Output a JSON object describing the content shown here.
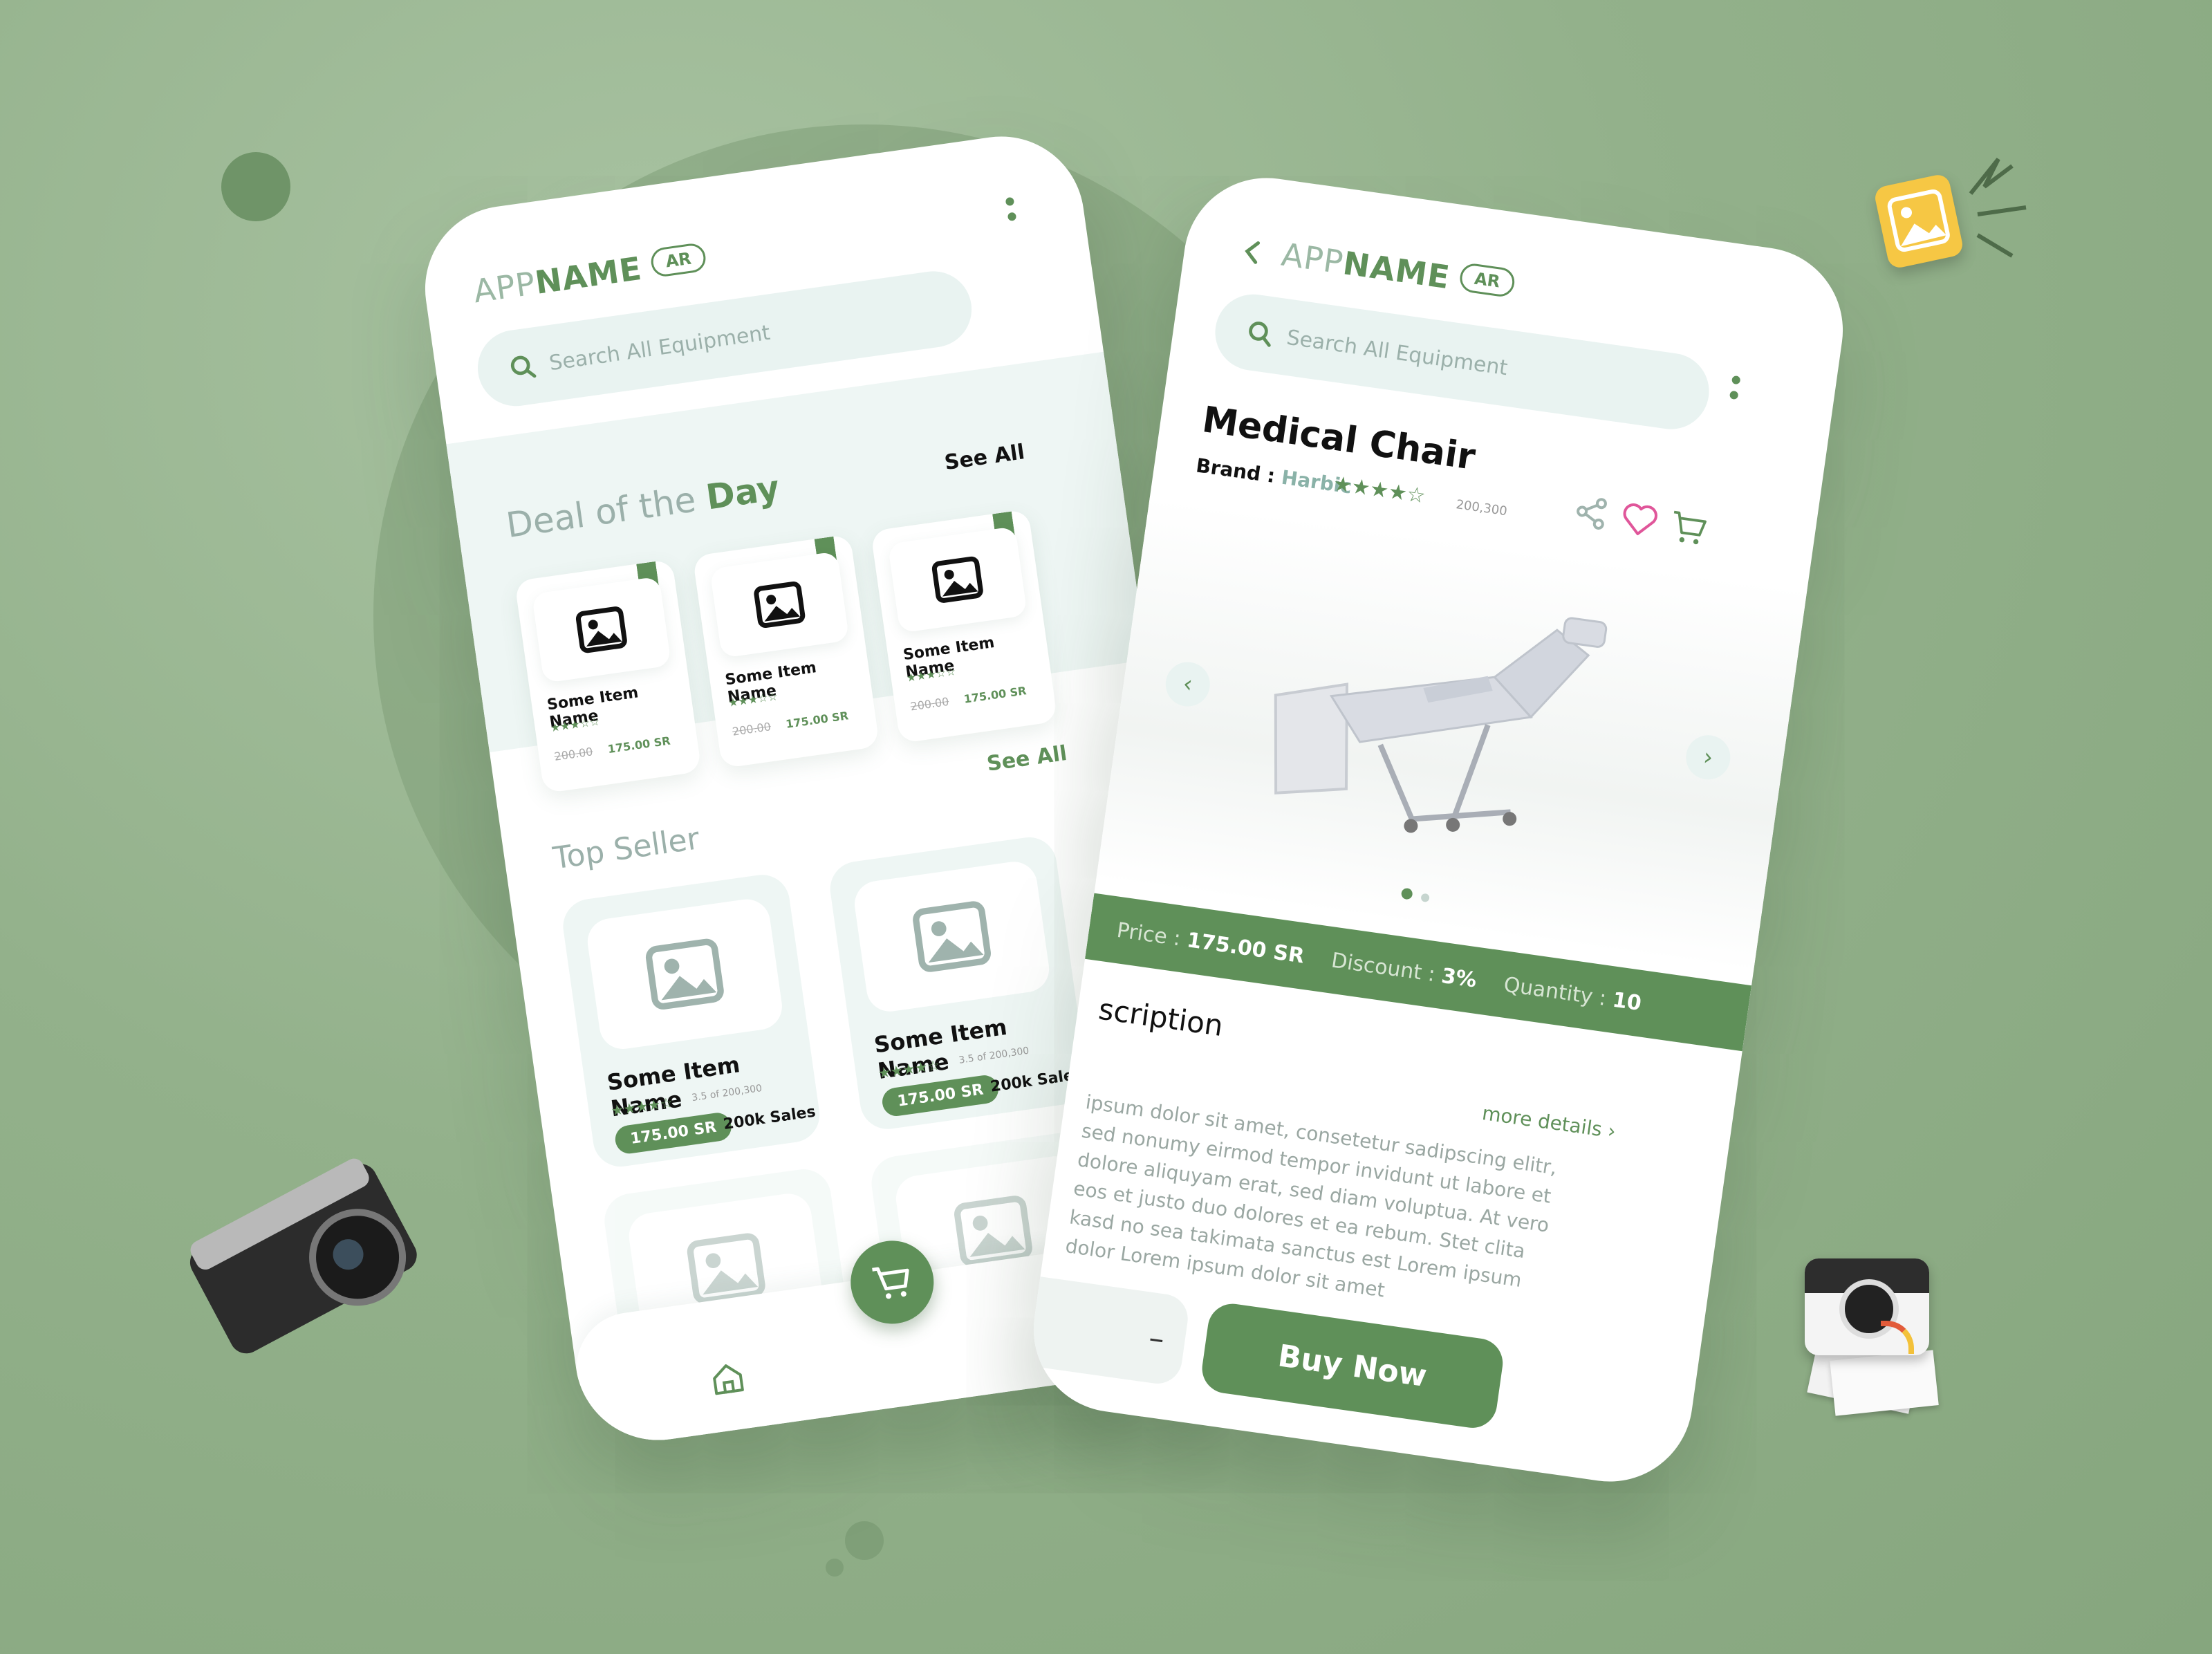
{
  "colors": {
    "brand": "#5f9059",
    "light": "#e9f3f1",
    "background": "#93b18b"
  },
  "left_screen": {
    "logo_light": "APP",
    "logo_bold": "NAME",
    "lang_badge": "AR",
    "search": {
      "placeholder": "Search All Equipment"
    },
    "deal": {
      "title_light": "Deal of the ",
      "title_bold": "Day",
      "see_all": "See All"
    },
    "deal_items": [
      {
        "name": "Some Item Name",
        "stars": "★★★☆☆",
        "old_price": "200.00",
        "new_price": "175.00 SR"
      },
      {
        "name": "Some Item Name",
        "stars": "★★★☆☆",
        "old_price": "200.00",
        "new_price": "175.00 SR"
      },
      {
        "name": "Some Item Name",
        "stars": "★★★☆☆",
        "old_price": "200.00",
        "new_price": "175.00 SR"
      }
    ],
    "top_seller": {
      "title": "Top Seller",
      "see_all": "See All"
    },
    "top_items": [
      {
        "name": "Some Item Name",
        "stars": "★★★★☆",
        "rating_text": "3.5 of 200,300",
        "price": "175.00 SR",
        "sales": "200k Sales"
      },
      {
        "name": "Some Item Name",
        "stars": "★★★★☆",
        "rating_text": "3.5 of 200,300",
        "price": "175.00 SR",
        "sales": "200k Sales"
      }
    ]
  },
  "right_screen": {
    "logo_light": "APP",
    "logo_bold": "NAME",
    "lang_badge": "AR",
    "search": {
      "placeholder": "Search All Equipment"
    },
    "product": {
      "title": "Medical Chair",
      "brand_label": "Brand : ",
      "brand_value": "Harbic",
      "stars": "★★★★☆",
      "reviews": "200,300"
    },
    "info": {
      "price_label": "Price : ",
      "price_value": "175.00 SR",
      "discount_label": "Discount : ",
      "discount_value": "3%",
      "quantity_label": "Quantity : ",
      "quantity_value": "10"
    },
    "description": {
      "title": "scription",
      "more": "more details",
      "text": "ipsum dolor sit amet, consetetur sadipscing elitr, sed nonumy eirmod tempor invidunt ut labore et dolore aliquyam erat, sed diam voluptua. At vero eos et justo duo dolores et ea rebum. Stet clita kasd no sea takimata sanctus est Lorem ipsum dolor Lorem ipsum dolor sit amet"
    },
    "qty_minus": "–",
    "buy_label": "Buy Now"
  },
  "icons": {
    "search": "search-icon",
    "menu": "more-vertical-icon",
    "back": "chevron-left-icon",
    "share": "share-icon",
    "heart": "heart-icon",
    "cart": "cart-icon",
    "home": "home-icon",
    "bag": "bag-icon",
    "image": "image-placeholder-icon"
  }
}
